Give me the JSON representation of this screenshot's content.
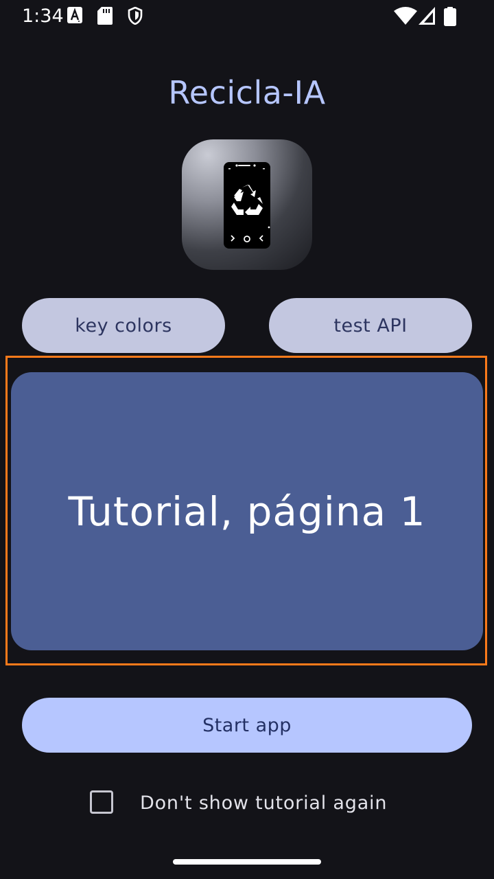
{
  "status_bar": {
    "time": "1:34",
    "icons": [
      "text-a-icon",
      "sd-card-icon",
      "shield-icon",
      "wifi-icon",
      "signal-icon",
      "battery-icon"
    ]
  },
  "app": {
    "title": "Recicla-IA",
    "logo_icon": "phone-recycle-icon"
  },
  "buttons": {
    "key_colors": "key colors",
    "test_api": "test API",
    "start_app": "Start app"
  },
  "tutorial": {
    "page_text": "Tutorial, página 1"
  },
  "checkbox": {
    "label": "Don't show tutorial again",
    "checked": false
  },
  "colors": {
    "background": "#131318",
    "accent": "#b6c6ff",
    "secondary_button": "#c3c7e0",
    "tutorial_card": "#4b5e94",
    "highlight": "#ff7a1a"
  }
}
